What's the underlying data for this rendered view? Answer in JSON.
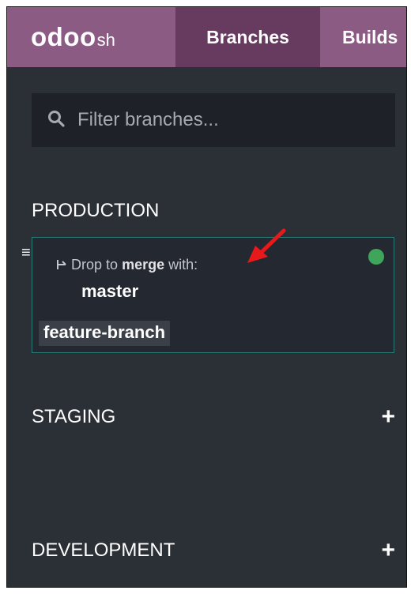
{
  "nav": {
    "logo_main": "odoo",
    "logo_sub": "sh",
    "tabs": [
      {
        "label": "Branches",
        "active": true
      },
      {
        "label": "Builds",
        "active": false
      }
    ]
  },
  "search": {
    "placeholder": "Filter branches...",
    "value": ""
  },
  "sections": {
    "production": {
      "label": "PRODUCTION",
      "drop_hint_prefix": "Drop to",
      "drop_hint_bold": "merge",
      "drop_hint_suffix": "with:",
      "merge_target": "master",
      "dragged_branch": "feature-branch",
      "status_color": "#3fa55a"
    },
    "staging": {
      "label": "STAGING",
      "add_label": "+"
    },
    "development": {
      "label": "DEVELOPMENT",
      "add_label": "+"
    }
  },
  "annotation": {
    "arrow_color": "#e8191b"
  },
  "colors": {
    "nav_bg": "#8c5b83",
    "nav_active": "#673a5f",
    "panel_bg": "#2b2f36",
    "card_border": "#2c7a76"
  }
}
